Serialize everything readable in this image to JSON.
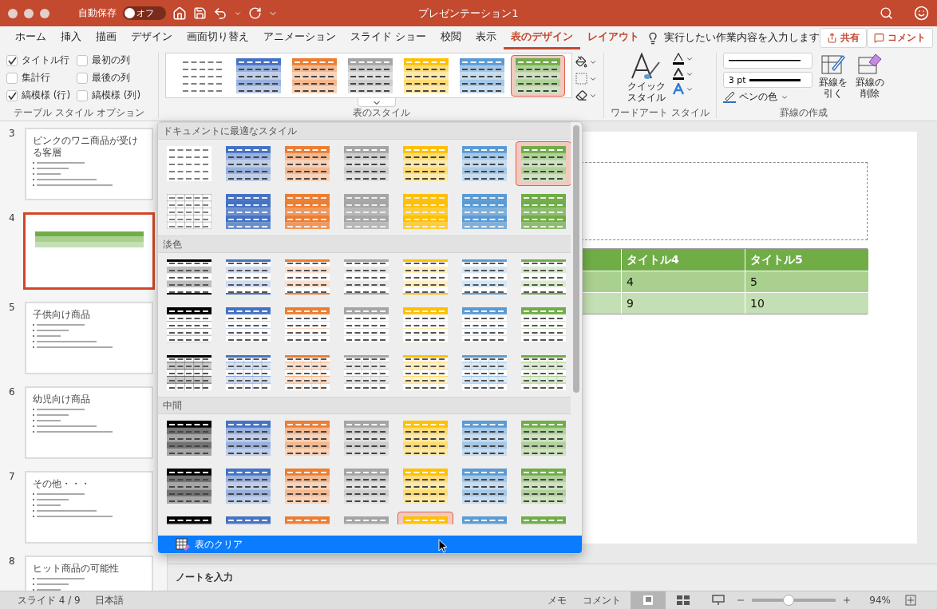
{
  "title_bar": {
    "autosave_label": "自動保存",
    "autosave_toggle": {
      "label": "オフ",
      "on": false
    },
    "title": "プレゼンテーション1"
  },
  "tabs": [
    {
      "label": "ホーム",
      "selected": false,
      "contextual": false
    },
    {
      "label": "挿入",
      "selected": false,
      "contextual": false
    },
    {
      "label": "描画",
      "selected": false,
      "contextual": false
    },
    {
      "label": "デザイン",
      "selected": false,
      "contextual": false
    },
    {
      "label": "画面切り替え",
      "selected": false,
      "contextual": false
    },
    {
      "label": "アニメーション",
      "selected": false,
      "contextual": false
    },
    {
      "label": "スライド ショー",
      "selected": false,
      "contextual": false
    },
    {
      "label": "校閲",
      "selected": false,
      "contextual": false
    },
    {
      "label": "表示",
      "selected": false,
      "contextual": false
    },
    {
      "label": "表のデザイン",
      "selected": true,
      "contextual": true
    },
    {
      "label": "レイアウト",
      "selected": false,
      "contextual": true
    }
  ],
  "tell_me": {
    "placeholder": "実行したい作業内容を入力します"
  },
  "share_button": "共有",
  "comment_button": "コメント",
  "ribbon": {
    "options": {
      "label": "テーブル スタイル オプション",
      "checkboxes": [
        {
          "label": "タイトル行",
          "checked": true
        },
        {
          "label": "最初の列",
          "checked": false
        },
        {
          "label": "集計行",
          "checked": false
        },
        {
          "label": "最後の列",
          "checked": false
        },
        {
          "label": "縞模様 (行)",
          "checked": true
        },
        {
          "label": "縞模様 (列)",
          "checked": false
        }
      ]
    },
    "styles": {
      "label": "表のスタイル",
      "swatches": [
        {
          "kind": "plain",
          "color": "#808080",
          "selected": false
        },
        {
          "kind": "banded",
          "color": "#4472c4",
          "selected": false
        },
        {
          "kind": "banded",
          "color": "#ed7d31",
          "selected": false
        },
        {
          "kind": "banded",
          "color": "#a5a5a5",
          "selected": false
        },
        {
          "kind": "banded",
          "color": "#ffc000",
          "selected": false
        },
        {
          "kind": "banded",
          "color": "#5b9bd5",
          "selected": false
        },
        {
          "kind": "banded",
          "color": "#70ad47",
          "selected": true
        }
      ]
    },
    "wordart": {
      "label": "ワードアート スタイル",
      "quick_style": "クイックスタイル"
    },
    "borders": {
      "label": "罫線の作成",
      "weight": "3 pt",
      "pen_color": "ペンの色",
      "draw": "罫線を引く",
      "erase": "罫線の削除"
    }
  },
  "slides": [
    {
      "number": "3",
      "selected": false,
      "kind": "text",
      "title": "ピンクのワニ商品が受ける客層"
    },
    {
      "number": "4",
      "selected": true,
      "kind": "table"
    },
    {
      "number": "5",
      "selected": false,
      "kind": "text",
      "title": "子供向け商品"
    },
    {
      "number": "6",
      "selected": false,
      "kind": "text",
      "title": "幼児向け商品"
    },
    {
      "number": "7",
      "selected": false,
      "kind": "text",
      "title": "その他・・・"
    },
    {
      "number": "8",
      "selected": false,
      "kind": "text",
      "title": "ヒット商品の可能性"
    }
  ],
  "slide_table": {
    "headers": [
      "タイトル4",
      "タイトル5"
    ],
    "rows": [
      [
        "4",
        "5"
      ],
      [
        "9",
        "10"
      ]
    ]
  },
  "notes": {
    "placeholder": "ノートを入力"
  },
  "gallery": {
    "sections": [
      {
        "title": "ドキュメントに最適なスタイル",
        "rows": [
          {
            "swatches": [
              {
                "kind": "plain",
                "color": "#808080",
                "selected": false
              },
              {
                "kind": "banded",
                "color": "#4472c4",
                "selected": false
              },
              {
                "kind": "banded",
                "color": "#ed7d31",
                "selected": false
              },
              {
                "kind": "banded",
                "color": "#a5a5a5",
                "selected": false
              },
              {
                "kind": "banded",
                "color": "#ffc000",
                "selected": false
              },
              {
                "kind": "banded",
                "color": "#5b9bd5",
                "selected": false
              },
              {
                "kind": "banded",
                "color": "#70ad47",
                "selected": true
              }
            ]
          },
          {
            "swatches": [
              {
                "kind": "grid",
                "color": "#808080",
                "selected": false
              },
              {
                "kind": "solid",
                "color": "#4472c4",
                "selected": false
              },
              {
                "kind": "solid",
                "color": "#ed7d31",
                "selected": false
              },
              {
                "kind": "solid",
                "color": "#a5a5a5",
                "selected": false
              },
              {
                "kind": "solid",
                "color": "#ffc000",
                "selected": false
              },
              {
                "kind": "solid",
                "color": "#5b9bd5",
                "selected": false
              },
              {
                "kind": "solid",
                "color": "#70ad47",
                "selected": false
              }
            ]
          }
        ]
      },
      {
        "title": "淡色",
        "rows": [
          {
            "swatches": [
              {
                "kind": "light-banded",
                "color": "#000000",
                "selected": false
              },
              {
                "kind": "light-banded",
                "color": "#4472c4",
                "selected": false
              },
              {
                "kind": "light-banded",
                "color": "#ed7d31",
                "selected": false
              },
              {
                "kind": "light-banded",
                "color": "#a5a5a5",
                "selected": false
              },
              {
                "kind": "light-banded",
                "color": "#ffc000",
                "selected": false
              },
              {
                "kind": "light-banded",
                "color": "#5b9bd5",
                "selected": false
              },
              {
                "kind": "light-banded",
                "color": "#70ad47",
                "selected": false
              }
            ]
          },
          {
            "swatches": [
              {
                "kind": "light-header",
                "color": "#000000",
                "selected": false
              },
              {
                "kind": "light-header",
                "color": "#4472c4",
                "selected": false
              },
              {
                "kind": "light-header",
                "color": "#ed7d31",
                "selected": false
              },
              {
                "kind": "light-header",
                "color": "#a5a5a5",
                "selected": false
              },
              {
                "kind": "light-header",
                "color": "#ffc000",
                "selected": false
              },
              {
                "kind": "light-header",
                "color": "#5b9bd5",
                "selected": false
              },
              {
                "kind": "light-header",
                "color": "#70ad47",
                "selected": false
              }
            ]
          },
          {
            "swatches": [
              {
                "kind": "light-grid",
                "color": "#000000",
                "selected": false
              },
              {
                "kind": "light-grid",
                "color": "#4472c4",
                "selected": false
              },
              {
                "kind": "light-grid",
                "color": "#ed7d31",
                "selected": false
              },
              {
                "kind": "light-grid",
                "color": "#a5a5a5",
                "selected": false
              },
              {
                "kind": "light-grid",
                "color": "#ffc000",
                "selected": false
              },
              {
                "kind": "light-grid",
                "color": "#5b9bd5",
                "selected": false
              },
              {
                "kind": "light-grid",
                "color": "#70ad47",
                "selected": false
              }
            ]
          }
        ]
      },
      {
        "title": "中間",
        "rows": [
          {
            "swatches": [
              {
                "kind": "banded",
                "color": "#000000",
                "selected": false
              },
              {
                "kind": "banded",
                "color": "#4472c4",
                "selected": false
              },
              {
                "kind": "banded",
                "color": "#ed7d31",
                "selected": false
              },
              {
                "kind": "banded",
                "color": "#a5a5a5",
                "selected": false
              },
              {
                "kind": "banded",
                "color": "#ffc000",
                "selected": false
              },
              {
                "kind": "banded",
                "color": "#5b9bd5",
                "selected": false
              },
              {
                "kind": "banded",
                "color": "#70ad47",
                "selected": false
              }
            ]
          },
          {
            "swatches": [
              {
                "kind": "banded",
                "color": "#000000",
                "selected": false
              },
              {
                "kind": "banded",
                "color": "#4472c4",
                "selected": false
              },
              {
                "kind": "banded",
                "color": "#ed7d31",
                "selected": false
              },
              {
                "kind": "banded",
                "color": "#a5a5a5",
                "selected": false
              },
              {
                "kind": "banded",
                "color": "#ffc000",
                "selected": false
              },
              {
                "kind": "banded",
                "color": "#5b9bd5",
                "selected": false
              },
              {
                "kind": "banded",
                "color": "#70ad47",
                "selected": false
              }
            ]
          },
          {
            "swatches": [
              {
                "kind": "banded",
                "color": "#000000",
                "selected": false
              },
              {
                "kind": "banded",
                "color": "#4472c4",
                "selected": false
              },
              {
                "kind": "banded",
                "color": "#ed7d31",
                "selected": false
              },
              {
                "kind": "banded",
                "color": "#a5a5a5",
                "selected": false
              },
              {
                "kind": "banded",
                "color": "#ffc000",
                "selected": true
              },
              {
                "kind": "banded",
                "color": "#5b9bd5",
                "selected": false
              },
              {
                "kind": "banded",
                "color": "#70ad47",
                "selected": false
              }
            ]
          }
        ]
      }
    ],
    "clear_item": "表のクリア"
  },
  "status_bar": {
    "slide": "スライド 4 / 9",
    "language": "日本語",
    "notes": "メモ",
    "comments": "コメント",
    "views": [
      {
        "kind": "normal",
        "selected": true
      },
      {
        "kind": "sorter",
        "selected": false
      },
      {
        "kind": "presenter",
        "selected": false
      }
    ],
    "zoom": {
      "level": 0.43,
      "reading": "94%"
    }
  }
}
